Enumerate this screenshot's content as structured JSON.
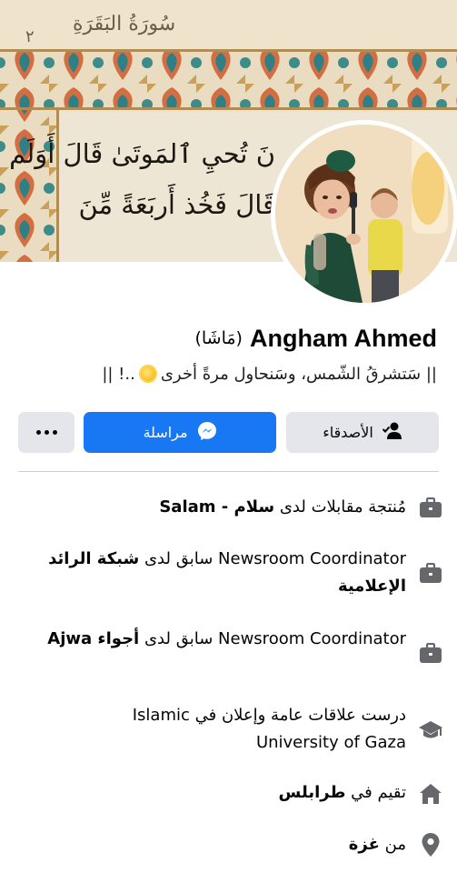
{
  "cover": {
    "header_script": "سُورَةُ البَقَرَةِ",
    "header_number": "٢",
    "verse_line_1": "نَ تُحيِ ٱلمَوتَىٰ قَالَ أَوَلَم",
    "verse_line_2": "قَالَ فَخُذ أَربَعَةً مِّنَ"
  },
  "profile": {
    "name": "Angham Ahmed",
    "alternate_name": "(مَاشَا)",
    "bio_text": "|| سَتشرقُ الشّمس، وسَنحاول مرةً أخرى",
    "bio_suffix": "..! ||"
  },
  "actions": {
    "friends_label": "الأصدقاء",
    "message_label": "مراسلة"
  },
  "info": {
    "work1_role": "مُنتجة مقابلات لدى",
    "work1_place": "سلام - Salam",
    "work2_title": "Newsroom Coordinator",
    "work2_mid": "سابق لدى",
    "work2_place": "شبكة الرائد الإعلامية",
    "work3_title": "Newsroom Coordinator",
    "work3_mid": "سابق لدى",
    "work3_place": "أجواء Ajwa",
    "edu_line1": "درست علاقات عامة وإعلان في Islamic",
    "edu_line2": "University of Gaza",
    "lives_prefix": "تقيم في",
    "lives_city": "طرابلس",
    "from_prefix": "من",
    "from_city": "غزة"
  },
  "icons": {
    "friends": "person-check-icon",
    "message": "messenger-icon",
    "more": "more-dots-icon",
    "work": "briefcase-icon",
    "education": "graduation-cap-icon",
    "home": "home-icon",
    "location": "location-pin-icon"
  },
  "colors": {
    "primary_blue": "#1877f2",
    "secondary_button": "#e4e6eb",
    "icon_gray": "#65676b"
  }
}
